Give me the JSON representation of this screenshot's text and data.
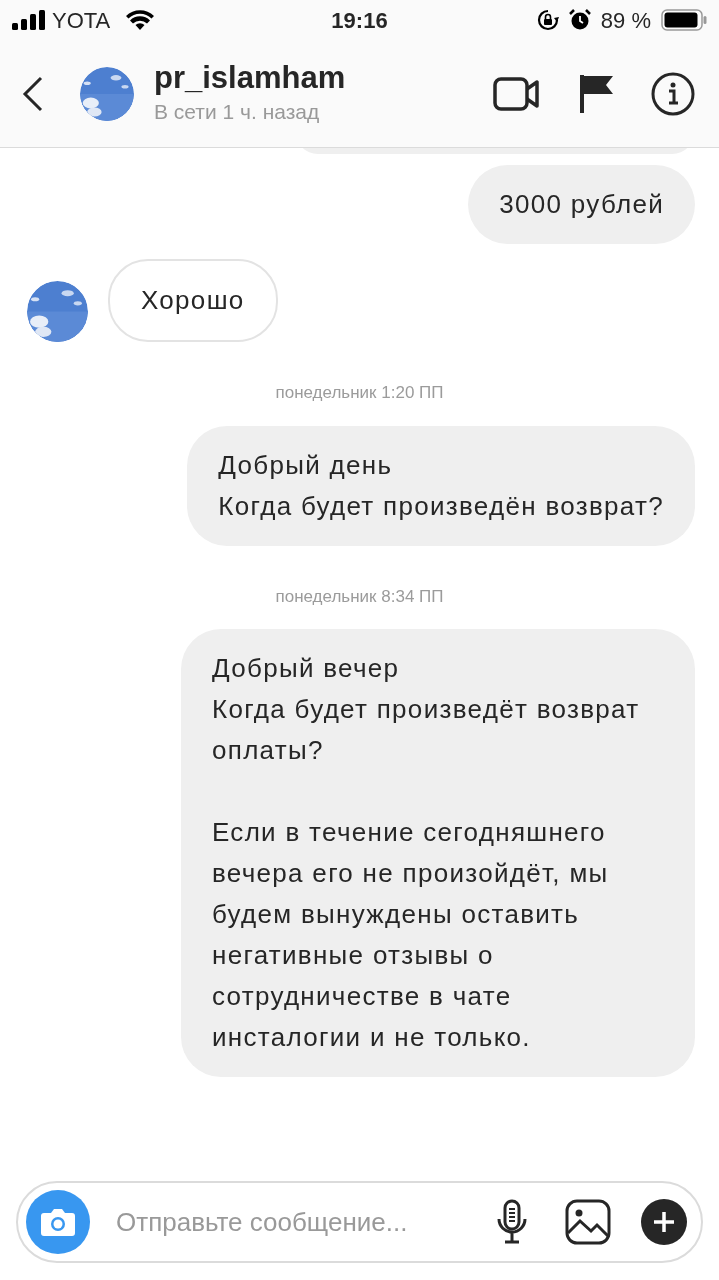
{
  "status_bar": {
    "carrier": "YOTA",
    "time": "19:16",
    "battery": "89 %"
  },
  "header": {
    "name": "pr_islamham",
    "status": "В сети 1 ч. назад"
  },
  "messages": [
    {
      "kind": "outgoing",
      "paragraphs": [
        [
          "3000 рублей"
        ]
      ]
    },
    {
      "kind": "incoming",
      "paragraphs": [
        [
          "Хорошо"
        ]
      ]
    },
    {
      "kind": "timestamp",
      "text": "понедельник 1:20 ПП"
    },
    {
      "kind": "outgoing",
      "paragraphs": [
        [
          "Добрый день",
          "Когда будет произведён возврат?"
        ]
      ]
    },
    {
      "kind": "timestamp",
      "text": "понедельник 8:34 ПП"
    },
    {
      "kind": "outgoing",
      "paragraphs": [
        [
          "Добрый вечер",
          "Когда будет произведёт возврат оплаты?"
        ],
        [
          "Если в течение сегодняшнего вечера его не произойдёт, мы будем вынуждены оставить негативные отзывы о сотрудничестве в чате инсталогии и не только."
        ]
      ]
    }
  ],
  "composer": {
    "placeholder": "Отправьте сообщение..."
  }
}
